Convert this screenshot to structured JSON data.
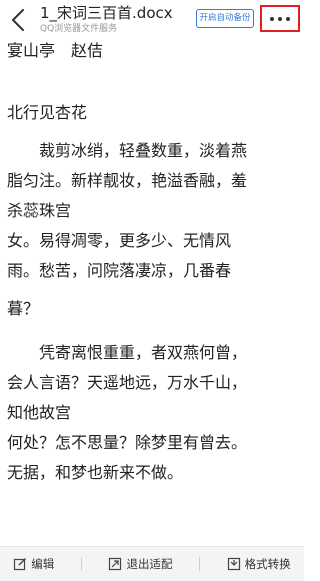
{
  "header": {
    "title": "1_宋词三百首.docx",
    "subtitle": "QQ浏览器文件服务",
    "backup_label": "开启自动备份",
    "more_label": "•••"
  },
  "doc": {
    "lines": [
      "宴山亭　赵佶",
      "",
      "北行见杏花",
      "裁剪冰绡，轻叠数重，淡着燕",
      "脂匀注。新样靓妆，艳溢香融，羞",
      "杀蕊珠宫",
      "女。易得凋零，更多少、无情风",
      "雨。愁苦，问院落凄凉，几番春",
      "暮？",
      "凭寄离恨重重，者双燕何曾，",
      "会人言语？天遥地远，万水千山，",
      "知他故宫",
      "何处？怎不思量？除梦里有曾去。",
      "无据，和梦也新来不做。"
    ]
  },
  "footer": {
    "edit_label": "编辑",
    "exit_label": "退出适配",
    "convert_label": "格式转换"
  }
}
